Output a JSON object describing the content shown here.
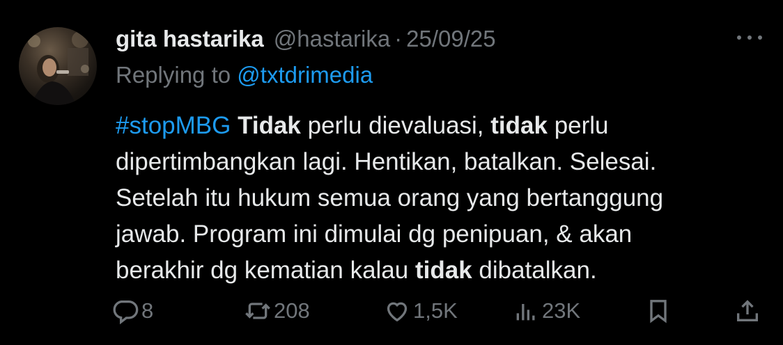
{
  "author": {
    "name": "gita hastarika",
    "handle": "@hastarika",
    "separator": "·",
    "date": "25/09/25"
  },
  "reply": {
    "prefix": "Replying to",
    "to": "@txtdrimedia"
  },
  "body": {
    "line1": {
      "hashtag": "#stopMBG",
      "bold1": "Tidak",
      "text1": " perlu dievaluasi, ",
      "bold2": "tidak",
      "text2": " perlu"
    },
    "line2": "dipertimbangkan lagi. Hentikan, batalkan. Selesai.",
    "line3": "Setelah itu hukum semua orang yang bertanggung",
    "line4": "jawab. Program ini dimulai dg penipuan, & akan",
    "line5": {
      "text1": "berakhir dg kematian kalau ",
      "bold": "tidak",
      "text2": " dibatalkan."
    }
  },
  "actions": {
    "replies": "8",
    "reposts": "208",
    "likes": "1,5K",
    "views": "23K"
  },
  "icons": {
    "more": "more-dots-icon",
    "reply": "reply-icon",
    "repost": "repost-icon",
    "like": "heart-icon",
    "views": "views-icon",
    "bookmark": "bookmark-icon",
    "share": "share-icon"
  },
  "colors": {
    "background": "#000000",
    "text": "#e7e9ea",
    "secondary": "#71767b",
    "accent": "#1d9bf0"
  }
}
